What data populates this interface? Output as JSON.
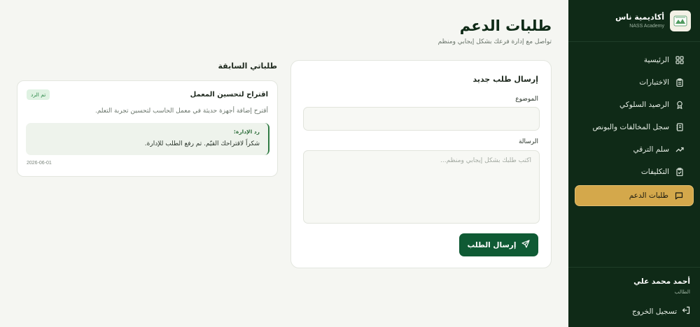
{
  "sidebar": {
    "brand_name": "أكاديمية ناس",
    "brand_sub": "NASS Academy",
    "items": [
      {
        "label": "الرئيسية",
        "icon": "grid-icon"
      },
      {
        "label": "الاختبارات",
        "icon": "clipboard-icon"
      },
      {
        "label": "الرصيد السلوكي",
        "icon": "award-icon"
      },
      {
        "label": "سجل المخالفات والبونص",
        "icon": "log-icon"
      },
      {
        "label": "سلم الترقي",
        "icon": "trending-up-icon"
      },
      {
        "label": "التكليفات",
        "icon": "task-icon"
      },
      {
        "label": "طلبات الدعم",
        "icon": "message-icon",
        "active": true
      }
    ],
    "user": {
      "name": "أحمد محمد علي",
      "role": "الطالب"
    },
    "logout_label": "تسجيل الخروج"
  },
  "main": {
    "title": "طلبات الدعم",
    "subtitle": "تواصل مع إدارة فرعك بشكل إيجابي ومنظم",
    "new_request": {
      "title": "إرسال طلب جديد",
      "subject_label": "الموضوع",
      "subject_value": "",
      "message_label": "الرسالة",
      "message_placeholder": "اكتب طلبك بشكل إيجابي ومنظم...",
      "send_label": "إرسال الطلب"
    },
    "previous": {
      "heading": "طلباتي السابقة",
      "items": [
        {
          "title": "اقتراح لتحسين المعمل",
          "status": "تم الرد",
          "body": "أقترح إضافة أجهزة حديثة في معمل الحاسب لتحسين تجربة التعلم.",
          "reply_label": "رد الإدارة:",
          "reply_text": "شكراً لاقتراحك القيّم. تم رفع الطلب للإدارة.",
          "date": "2026-06-01"
        }
      ]
    }
  },
  "colors": {
    "sidebar_bg": "#0f2a17",
    "active_item": "#d4a84b",
    "primary_button": "#0f5a34",
    "badge_bg": "#dff2e2",
    "badge_text": "#2f8a4b"
  }
}
